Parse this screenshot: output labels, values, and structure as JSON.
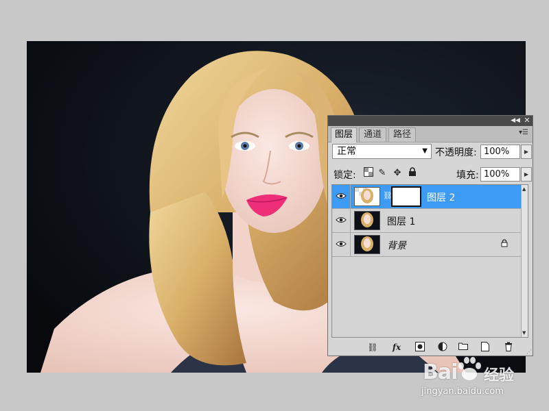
{
  "panel": {
    "tabs": [
      {
        "label": "图层",
        "active": true
      },
      {
        "label": "通道",
        "active": false
      },
      {
        "label": "路径",
        "active": false
      }
    ],
    "blend_mode": "正常",
    "opacity_label": "不透明度:",
    "opacity_value": "100%",
    "lock_label": "锁定:",
    "fill_label": "填充:",
    "fill_value": "100%",
    "layers": [
      {
        "name": "图层 2",
        "selected": true,
        "visible": true,
        "has_mask": true,
        "locked": false
      },
      {
        "name": "图层 1",
        "selected": false,
        "visible": true,
        "has_mask": false,
        "locked": false
      },
      {
        "name": "背景",
        "selected": false,
        "visible": true,
        "has_mask": false,
        "locked": true
      }
    ]
  },
  "colors": {
    "selection": "#3d9bf3",
    "panel_bg": "#d6d6d6",
    "workspace": "#c8c8c8",
    "lip_color": "#ef2e78"
  },
  "icons": {
    "lock": [
      "lock-transparent-icon",
      "lock-brush-icon",
      "lock-move-icon",
      "lock-all-icon"
    ],
    "bottom": [
      "link-layers-icon",
      "fx-icon",
      "add-mask-icon",
      "adjustment-icon",
      "group-icon",
      "new-layer-icon",
      "delete-icon"
    ]
  },
  "watermark": {
    "brand": "Bai",
    "brand_suffix": "经验",
    "url": "jingyan.baidu.com"
  }
}
